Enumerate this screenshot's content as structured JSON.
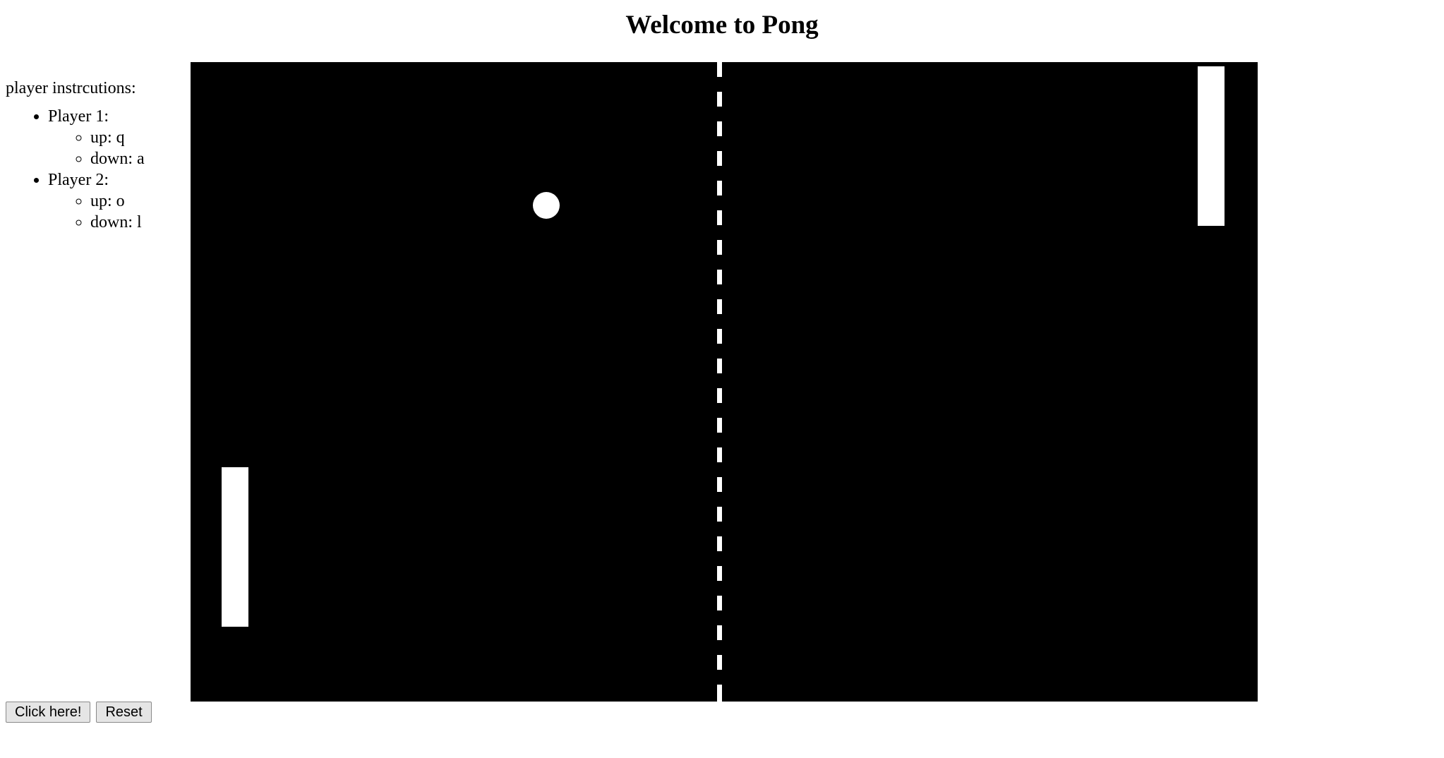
{
  "page": {
    "title": "Welcome to Pong"
  },
  "instructions": {
    "heading": "player instrcutions:",
    "players": [
      {
        "label": "Player 1:",
        "up": "up: q",
        "down": "down: a"
      },
      {
        "label": "Player 2:",
        "up": "up: o",
        "down": "down: l"
      }
    ]
  },
  "game": {
    "background_color": "#000000",
    "foreground_color": "#ffffff",
    "center_line_style": "dashed",
    "ball_shape": "circle"
  },
  "controls": {
    "start_label": "Click here!",
    "reset_label": "Reset"
  }
}
